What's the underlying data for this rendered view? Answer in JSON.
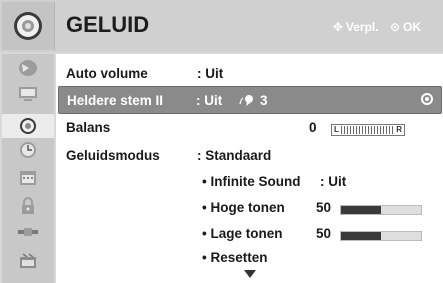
{
  "header": {
    "title": "GELUID",
    "move_hint": "Verpl.",
    "ok_hint": "OK",
    "move_icon": "dpad-arrows-icon",
    "ok_icon": "ok-circle-icon"
  },
  "sidebar": {
    "items": [
      {
        "name": "picture-icon"
      },
      {
        "name": "monitor-icon"
      },
      {
        "name": "speaker-icon",
        "active": true
      },
      {
        "name": "clock-icon"
      },
      {
        "name": "calendar-icon"
      },
      {
        "name": "lock-icon"
      },
      {
        "name": "input-plug-icon"
      },
      {
        "name": "usb-icon"
      }
    ]
  },
  "settings": {
    "auto_volume": {
      "label": "Auto volume",
      "value": ": Uit"
    },
    "clear_voice": {
      "label": "Heldere stem II",
      "value": ": Uit",
      "level": "3"
    },
    "balance": {
      "label": "Balans",
      "value": "0",
      "left": "L",
      "right": "R"
    },
    "sound_mode": {
      "label": "Geluidsmodus",
      "value": ": Standaard"
    },
    "infinite_sound": {
      "label": "• Infinite Sound",
      "value": ": Uit"
    },
    "treble": {
      "label": "• Hoge tonen",
      "value": "50",
      "level": 0.5
    },
    "bass": {
      "label": "• Lage tonen",
      "value": "50",
      "level": 0.5
    },
    "reset": {
      "label": "• Resetten"
    }
  },
  "colors": {
    "selected_row": "#8a8a8a",
    "header_bg": "#d0d0d0",
    "panel_bg": "#ffffff"
  }
}
